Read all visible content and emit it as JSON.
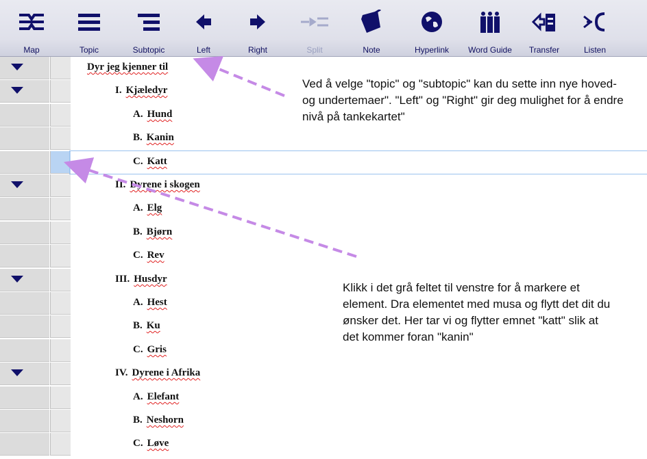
{
  "toolbar": {
    "buttons": [
      {
        "id": "map",
        "label": "Map",
        "icon": "map-icon",
        "disabled": false
      },
      {
        "id": "topic",
        "label": "Topic",
        "icon": "topic-icon",
        "disabled": false
      },
      {
        "id": "subtopic",
        "label": "Subtopic",
        "icon": "subtopic-icon",
        "disabled": false
      },
      {
        "id": "left",
        "label": "Left",
        "icon": "arrow-left-icon",
        "disabled": false
      },
      {
        "id": "right",
        "label": "Right",
        "icon": "arrow-right-icon",
        "disabled": false
      },
      {
        "id": "split",
        "label": "Split",
        "icon": "split-icon",
        "disabled": true
      },
      {
        "id": "note",
        "label": "Note",
        "icon": "note-icon",
        "disabled": false
      },
      {
        "id": "hyperlink",
        "label": "Hyperlink",
        "icon": "globe-icon",
        "disabled": false
      },
      {
        "id": "wordguide",
        "label": "Word Guide",
        "icon": "book-icon",
        "disabled": false
      },
      {
        "id": "transfer",
        "label": "Transfer",
        "icon": "transfer-icon",
        "disabled": false
      },
      {
        "id": "listen",
        "label": "Listen",
        "icon": "listen-icon",
        "disabled": false
      }
    ]
  },
  "outline": [
    {
      "num": "",
      "text": "Dyr jeg kjenner til",
      "collapsible": true
    },
    {
      "num": "I.",
      "text": "Kjæledyr",
      "collapsible": true
    },
    {
      "num": "A.",
      "text": "Hund",
      "collapsible": false
    },
    {
      "num": "B.",
      "text": "Kanin",
      "collapsible": false
    },
    {
      "num": "C.",
      "text": "Katt",
      "collapsible": false,
      "selected": true
    },
    {
      "num": "II.",
      "text": "Dyrene i skogen",
      "collapsible": true
    },
    {
      "num": "A.",
      "text": "Elg",
      "collapsible": false
    },
    {
      "num": "B.",
      "text": "Bjørn",
      "collapsible": false
    },
    {
      "num": "C.",
      "text": "Rev",
      "collapsible": false
    },
    {
      "num": "III.",
      "text": "Husdyr",
      "collapsible": true
    },
    {
      "num": "A.",
      "text": "Hest",
      "collapsible": false
    },
    {
      "num": "B.",
      "text": "Ku",
      "collapsible": false
    },
    {
      "num": "C.",
      "text": "Gris",
      "collapsible": false
    },
    {
      "num": "IV.",
      "text": "Dyrene i Afrika",
      "collapsible": true
    },
    {
      "num": "A.",
      "text": "Elefant",
      "collapsible": false
    },
    {
      "num": "B.",
      "text": "Neshorn",
      "collapsible": false
    },
    {
      "num": "C.",
      "text": "Løve",
      "collapsible": false
    }
  ],
  "annotations": {
    "top_note": "Ved å velge \"topic\" og \"subtopic\" kan du sette inn nye hoved- og undertemaer\". \"Left\" og \"Right\" gir deg mulighet for å endre nivå på tankekartet\"",
    "bottom_note": "Klikk i det grå feltet til venstre for å markere et element. Dra elementet med musa og flytt det dit du ønsker det. Her tar vi og flytter emnet \"katt\" slik at det kommer foran \"kanin\""
  },
  "colors": {
    "toolbar_icon": "#10106a",
    "arrow": "#c58ae6",
    "spelling_underline": "#e02020",
    "selection": "#b9d4f3"
  }
}
